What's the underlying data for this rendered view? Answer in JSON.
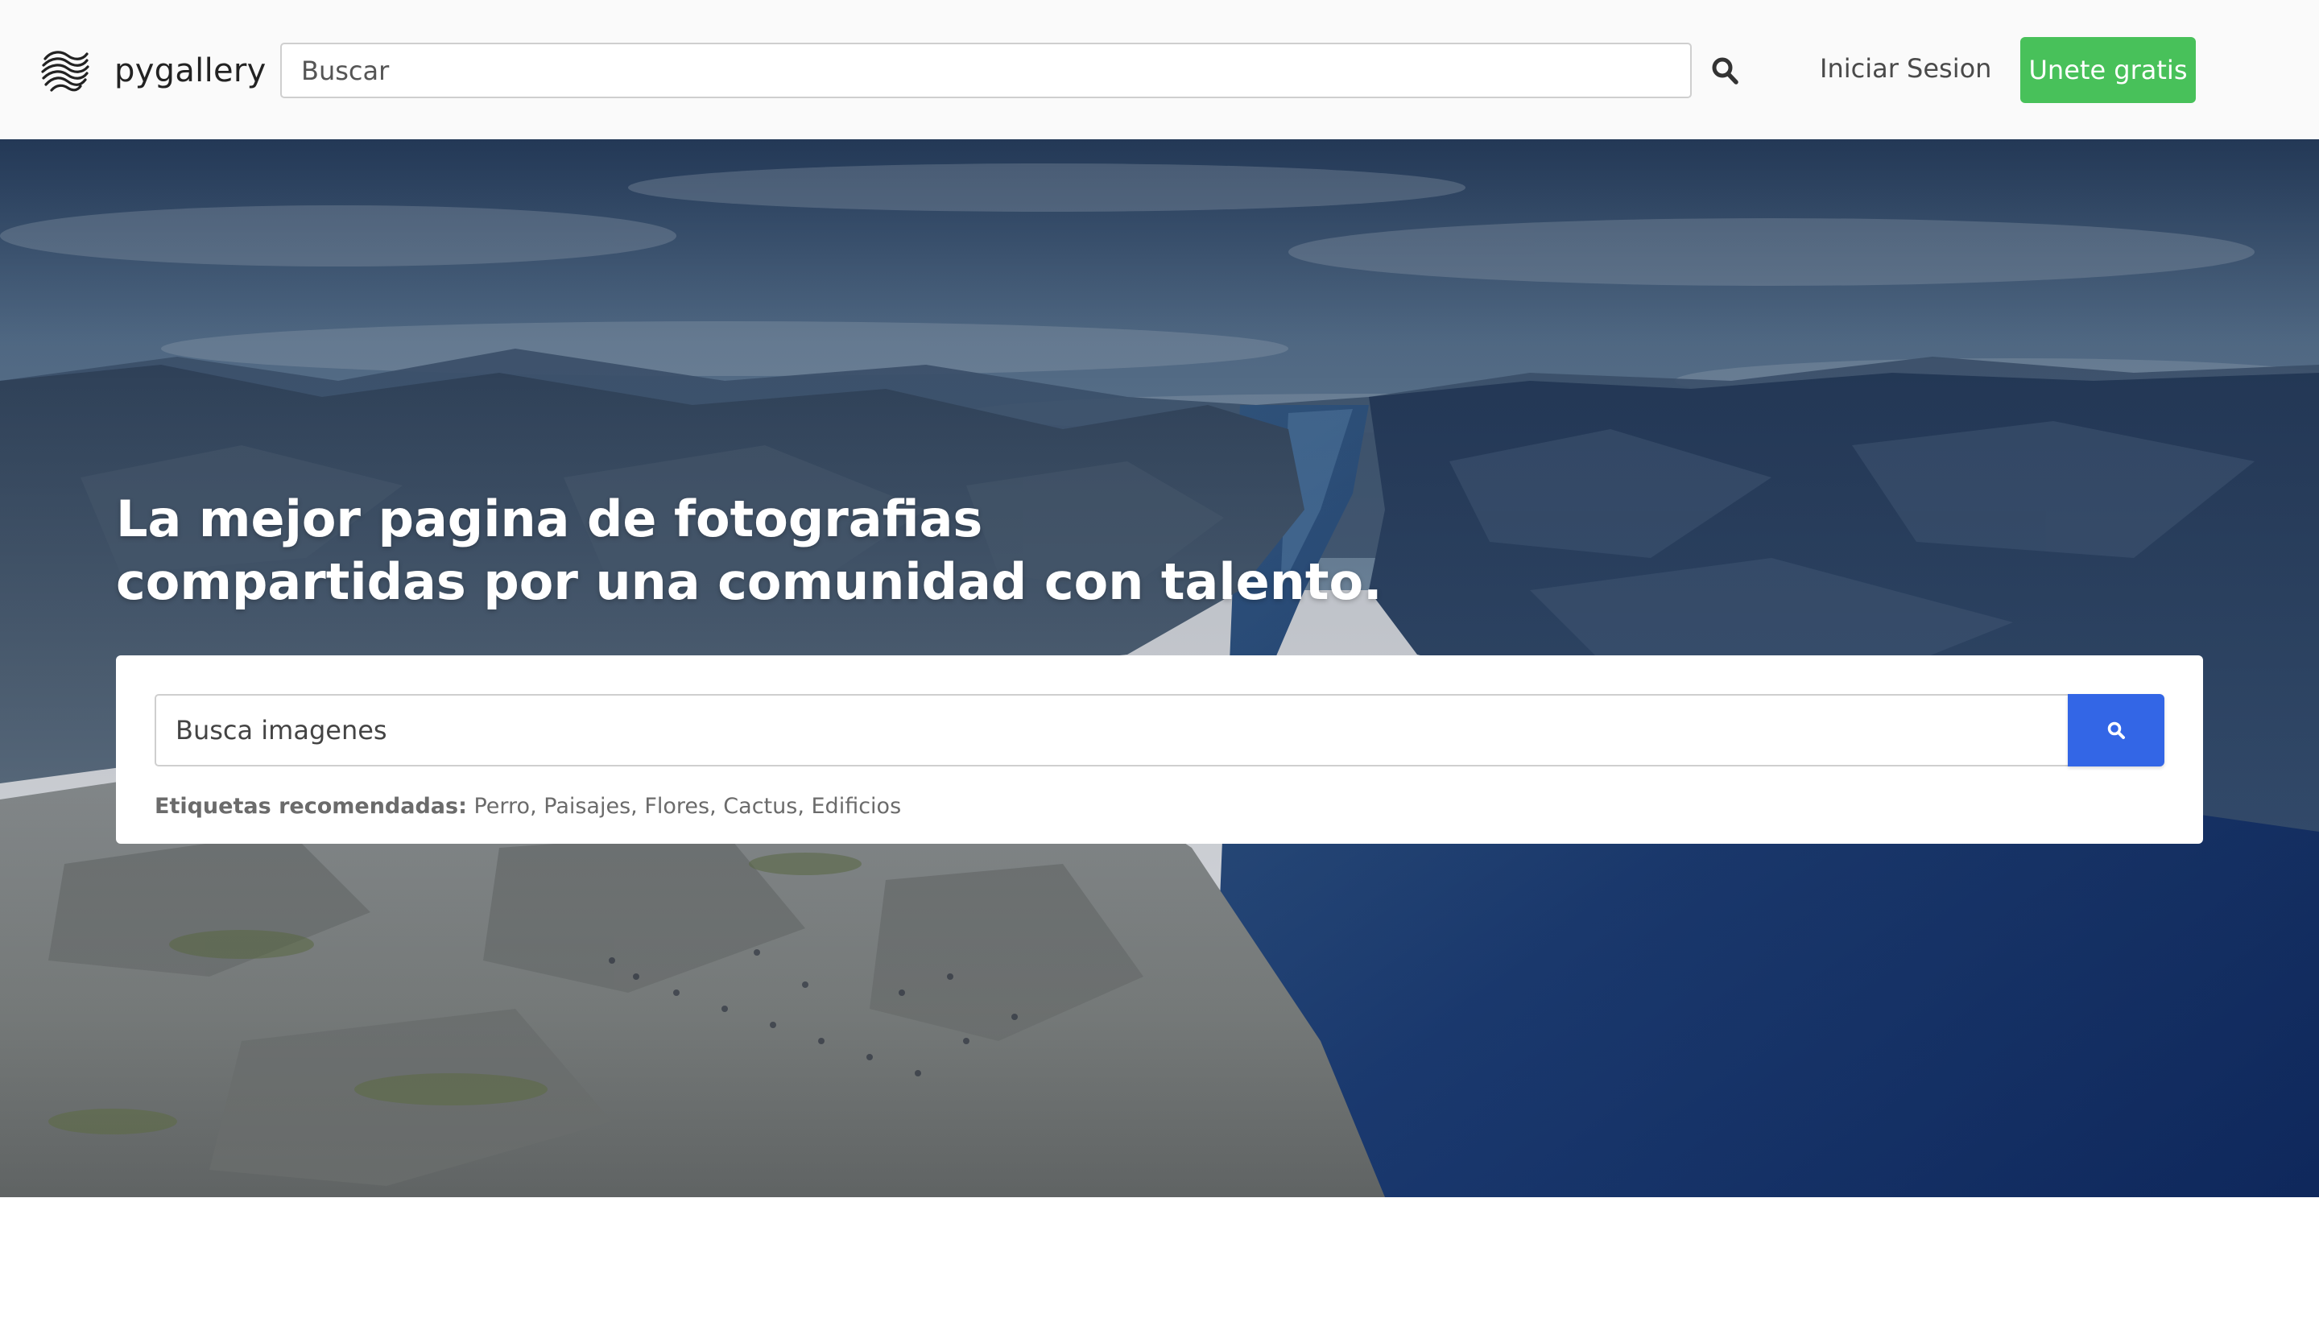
{
  "header": {
    "brand_name": "pygallery",
    "search_placeholder": "Buscar",
    "login_label": "Iniciar Sesion",
    "join_label": "Unete gratis",
    "join_color": "#48c15a"
  },
  "hero": {
    "title_line_1": "La mejor pagina de fotografias",
    "title_line_2": "compartidas por una comunidad con talento.",
    "search_placeholder": "Busca imagenes",
    "search_button_color": "#3366e6",
    "tags_label": "Etiquetas recomendadas:",
    "tags": [
      "Perro",
      "Paisajes",
      "Flores",
      "Cactus",
      "Edificios"
    ]
  },
  "icons": {
    "logo": "wavy-lines-logo-icon",
    "nav_search": "search-icon",
    "hero_search": "search-icon"
  }
}
